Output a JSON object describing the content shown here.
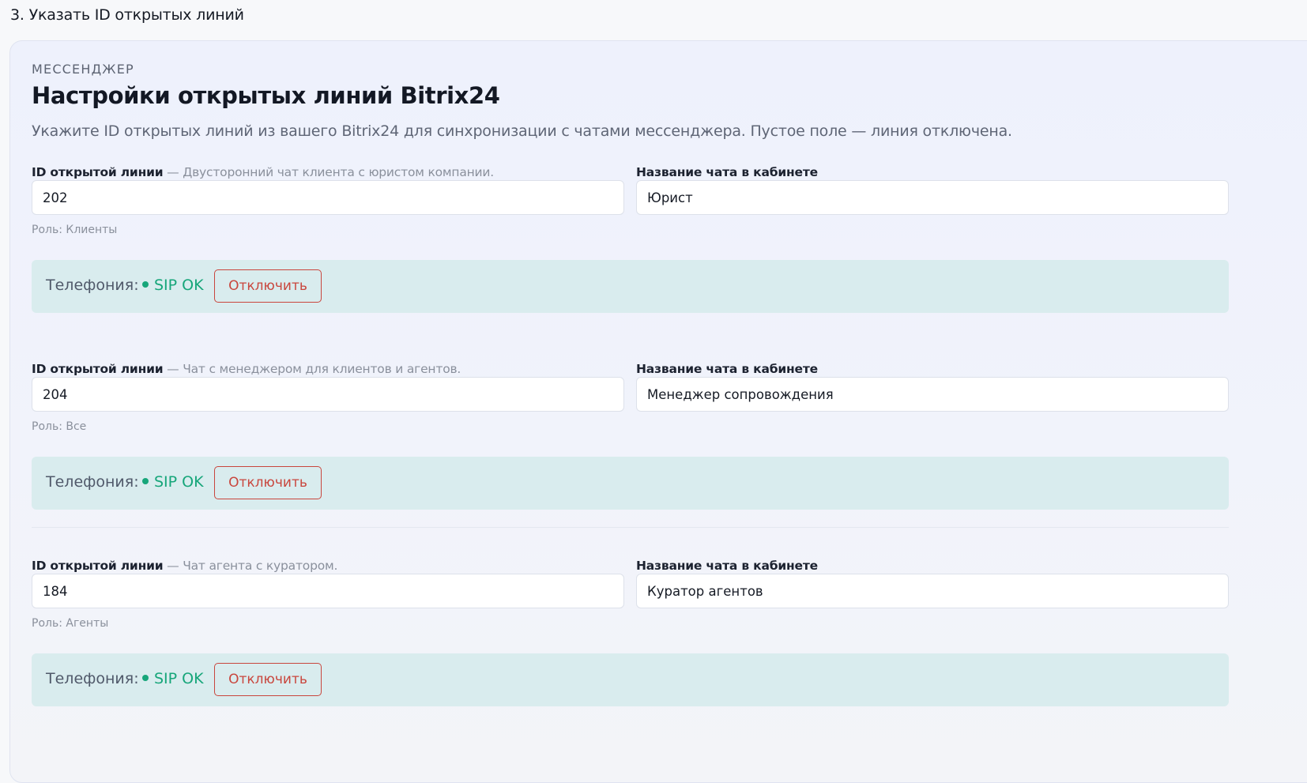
{
  "step_title": "3. Указать ID открытых линий",
  "section": {
    "eyebrow": "МЕССЕНДЖЕР",
    "heading": "Настройки открытых линий Bitrix24",
    "subtitle": "Укажите ID открытых линий из вашего Bitrix24 для синхронизации с чатами мессенджера. Пустое поле — линия отключена."
  },
  "labels": {
    "line_id": "ID открытой линии",
    "chat_name": "Название чата в кабинете",
    "telephony": "Телефония:",
    "disable_button": "Отключить"
  },
  "lines": [
    {
      "description": "— Двусторонний чат клиента с юристом компании.",
      "line_id": "202",
      "chat_name": "Юрист",
      "role": "Роль: Клиенты",
      "sip_status": "SIP OK"
    },
    {
      "description": "— Чат с менеджером для клиентов и агентов.",
      "line_id": "204",
      "chat_name": "Менеджер сопровождения",
      "role": "Роль: Все",
      "sip_status": "SIP OK"
    },
    {
      "description": "— Чат агента с куратором.",
      "line_id": "184",
      "chat_name": "Куратор агентов",
      "role": "Роль: Агенты",
      "sip_status": "SIP OK"
    }
  ],
  "colors": {
    "sip_ok": "#17a67a",
    "disable": "#c9463d",
    "telephony_bar": "#d9ecee"
  }
}
